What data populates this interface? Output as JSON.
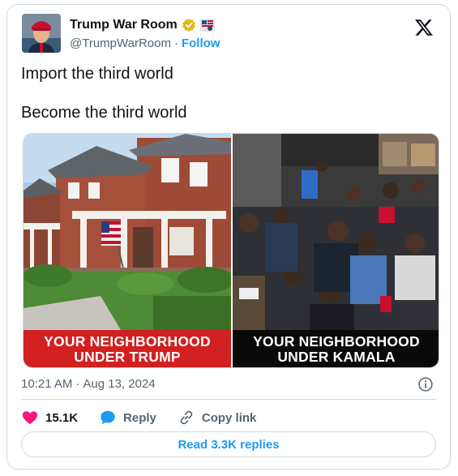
{
  "author": {
    "display_name": "Trump War Room",
    "handle": "@TrumpWarRoom",
    "separator": "·",
    "follow_label": "Follow",
    "avatar_icon": "avatar-photo",
    "verified_icon": "gold-verified-badge-icon",
    "extra_icon": "flag-emoji-icon"
  },
  "tweet": {
    "line1": "Import the third world",
    "line2": "Become the third world"
  },
  "media": {
    "left_caption_line1": "YOUR NEIGHBORHOOD",
    "left_caption_line2": "UNDER TRUMP",
    "right_caption_line1": "YOUR NEIGHBORHOOD",
    "right_caption_line2": "UNDER KAMALA",
    "left_caption_color": "#d21f1f",
    "right_caption_color": "#0a0a0a"
  },
  "meta": {
    "time": "10:21 AM",
    "separator": "·",
    "date": "Aug 13, 2024"
  },
  "actions": {
    "like_count": "15.1K",
    "reply_label": "Reply",
    "copy_link_label": "Copy link"
  },
  "read_replies_label": "Read 3.3K replies",
  "colors": {
    "accent": "#1d9bf0",
    "like": "#f91880",
    "text": "#0f1419",
    "secondary": "#536471",
    "border": "#cfd9de"
  }
}
